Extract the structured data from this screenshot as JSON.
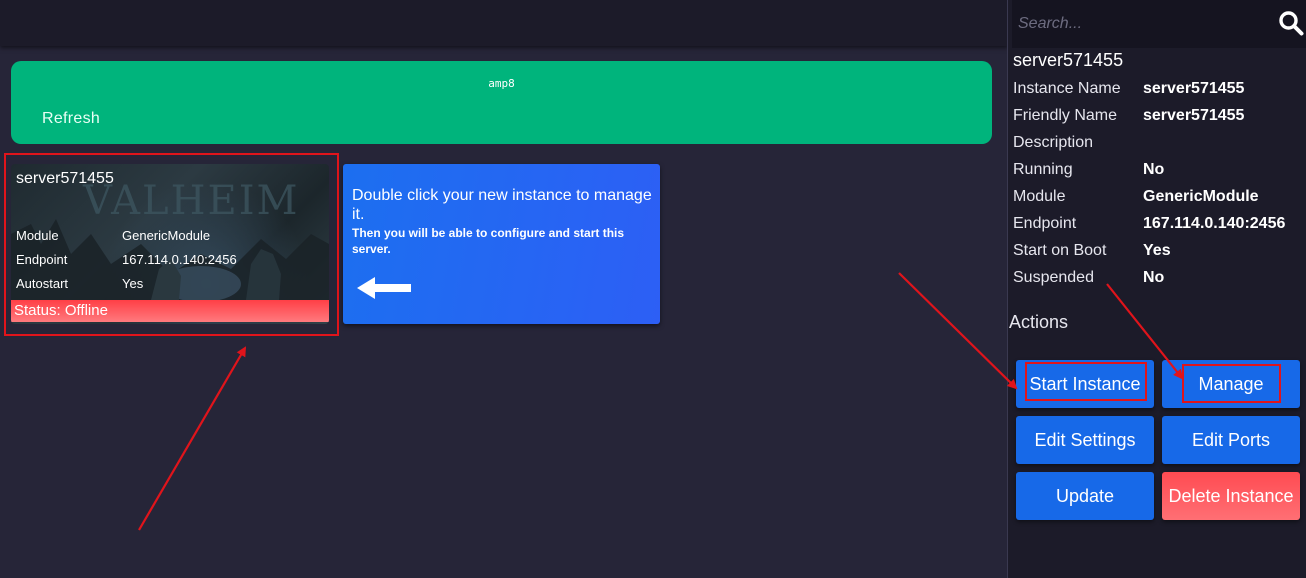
{
  "search": {
    "placeholder": "Search..."
  },
  "banner": {
    "title": "amp8",
    "refresh_label": "Refresh"
  },
  "instance_card": {
    "name": "server571455",
    "background_art_text": "VALHEIM",
    "rows": [
      {
        "key": "Module",
        "value": "GenericModule"
      },
      {
        "key": "Endpoint",
        "value": "167.114.0.140:2456"
      },
      {
        "key": "Autostart",
        "value": "Yes"
      }
    ],
    "status": "Status: Offline"
  },
  "hint": {
    "main": "Double click your new instance to manage it.",
    "sub": "Then you will be able to configure and start this server.",
    "arrow_icon": "arrow-left-icon"
  },
  "details": {
    "title": "server571455",
    "properties": [
      {
        "key": "Instance Name",
        "value": "server571455"
      },
      {
        "key": "Friendly Name",
        "value": "server571455"
      },
      {
        "key": "Description",
        "value": ""
      },
      {
        "key": "Running",
        "value": "No"
      },
      {
        "key": "Module",
        "value": "GenericModule"
      },
      {
        "key": "Endpoint",
        "value": "167.114.0.140:2456"
      },
      {
        "key": "Start on Boot",
        "value": "Yes"
      },
      {
        "key": "Suspended",
        "value": "No"
      }
    ],
    "actions_heading": "Actions",
    "actions": [
      {
        "id": "start-instance",
        "label": "Start Instance"
      },
      {
        "id": "manage",
        "label": "Manage"
      },
      {
        "id": "edit-settings",
        "label": "Edit Settings"
      },
      {
        "id": "edit-ports",
        "label": "Edit Ports"
      },
      {
        "id": "update",
        "label": "Update"
      },
      {
        "id": "delete-instance",
        "label": "Delete Instance"
      }
    ]
  },
  "colors": {
    "background": "#262538",
    "panel": "#1c1b29",
    "banner_green": "#00b47c",
    "primary_blue": "#1769e8",
    "danger_red": "#ff4b52",
    "annotation_red": "#e0141b"
  }
}
